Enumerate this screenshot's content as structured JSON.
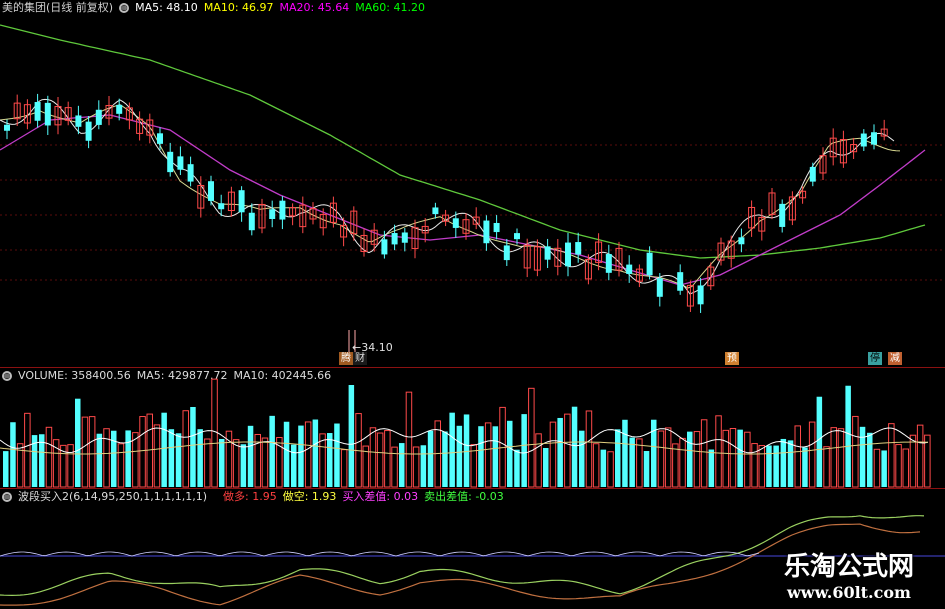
{
  "main": {
    "title": "美的集团(日线 前复权)",
    "ma5_label": "MA5: 48.10",
    "ma10_label": "MA10: 46.97",
    "ma20_label": "MA20: 45.64",
    "ma60_label": "MA60: 41.20",
    "low_marker": "←34.10",
    "event_tags": [
      "腾",
      "财",
      "预",
      "停",
      "减"
    ]
  },
  "volume": {
    "title": "VOLUME: 358400.56",
    "ma5_label": "MA5: 429877.72",
    "ma10_label": "MA10: 402445.66"
  },
  "indicator": {
    "title": "波段买入2(6,14,95,250,1,1,1,1,1,1)",
    "duo_label": "做多: 1.95",
    "kong_label": "做空: 1.93",
    "buy_label": "买入差值: 0.03",
    "sell_label": "卖出差值: -0.03"
  },
  "watermark": {
    "line1": "乐淘公式网",
    "line2": "www.60lt.com"
  },
  "colors": {
    "up": "#ff4a4a",
    "down": "#54ffff",
    "ma5": "#ffffff",
    "ma10": "#ffff00",
    "ma20": "#ff00ff",
    "ma60": "#00ff00",
    "ma_line5": "#e8e8e8",
    "ma_line20": "#c03cc8",
    "ma_line60": "#5fc83c",
    "separator": "#8b1111"
  }
}
